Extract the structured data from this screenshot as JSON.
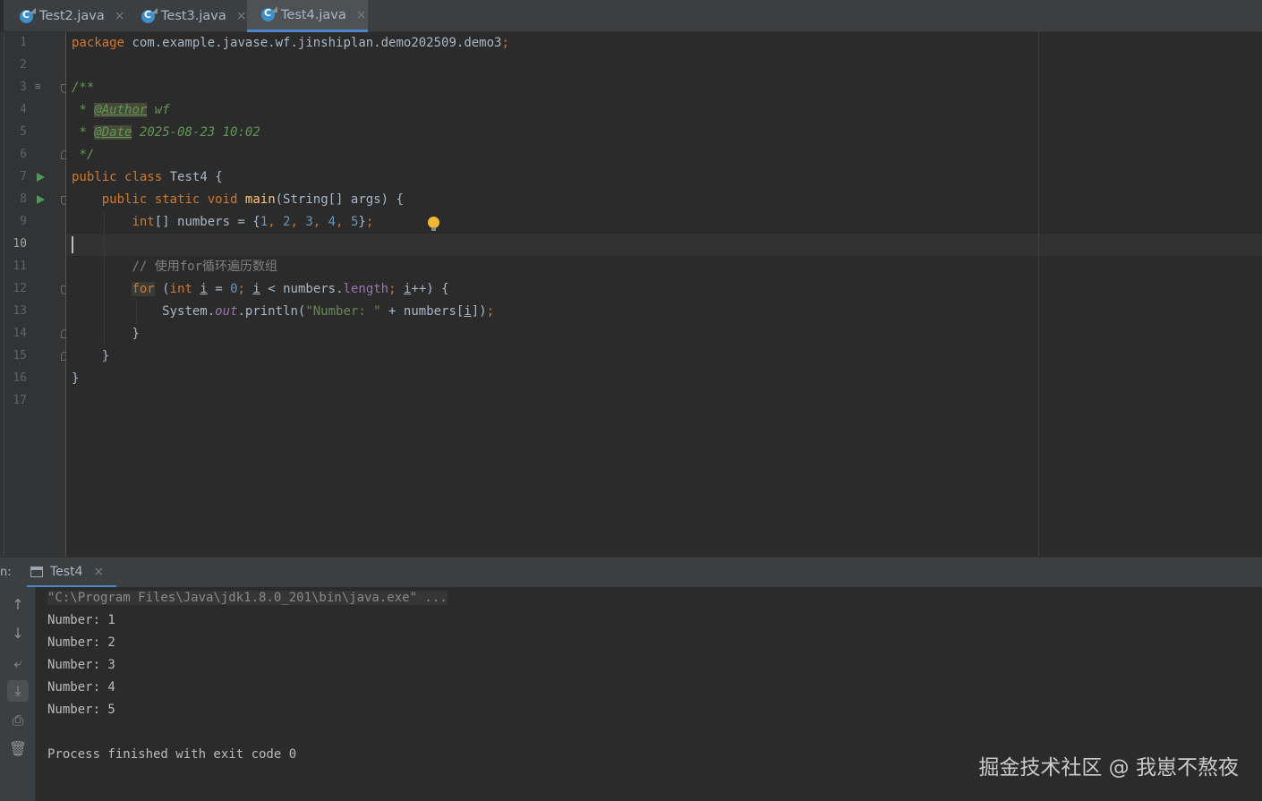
{
  "tabs": [
    {
      "name": "Test2.java",
      "active": false
    },
    {
      "name": "Test3.java",
      "active": false
    },
    {
      "name": "Test4.java",
      "active": true
    }
  ],
  "editor": {
    "line_numbers": [
      "1",
      "2",
      "3",
      "4",
      "5",
      "6",
      "7",
      "8",
      "9",
      "10",
      "11",
      "12",
      "13",
      "14",
      "15",
      "16",
      "17"
    ],
    "current_line": "10",
    "package_kw": "package",
    "package_name": "com.example.javase.wf.jinshiplan.demo202509.demo3",
    "doc_open": "/**",
    "doc_star": "*",
    "author_tag": "@Author",
    "author_value": "wf",
    "date_tag": "@Date",
    "date_value": "2025-08-23 10:02",
    "doc_close": "*/",
    "public": "public",
    "class": "class",
    "class_name": "Test4",
    "static": "static",
    "void": "void",
    "main": "main",
    "main_params": "(String[] args) {",
    "int": "int",
    "array_decl": "[] numbers = {",
    "numbers": [
      "1",
      "2",
      "3",
      "4",
      "5"
    ],
    "comment": "// 使用for循环遍历数组",
    "for": "for",
    "zero": "0",
    "i": "i",
    "length": "length",
    "println_prefix": "System.",
    "out": "out",
    "println": ".println(",
    "println_str": "\"Number: \"",
    "println_rest": " + numbers[",
    "brace_close": "}"
  },
  "run_panel": {
    "label": "n:",
    "tab_name": "Test4",
    "command": "\"C:\\Program Files\\Java\\jdk1.8.0_201\\bin\\java.exe\" ...",
    "output": [
      "Number: 1",
      "Number: 2",
      "Number: 3",
      "Number: 4",
      "Number: 5"
    ],
    "finish": "Process finished with exit code 0"
  },
  "watermark": "掘金技术社区 @ 我崽不熬夜"
}
